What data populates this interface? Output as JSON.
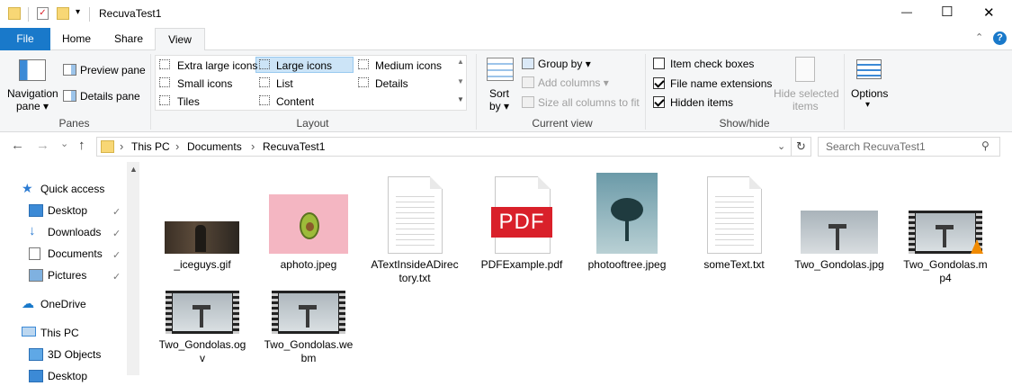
{
  "window": {
    "title": "RecuvaTest1",
    "min_label": "—",
    "max_label": "☐",
    "close_label": "✕"
  },
  "tabs": {
    "file": "File",
    "home": "Home",
    "share": "Share",
    "view": "View"
  },
  "ribbon": {
    "panes": {
      "navigation_pane": "Navigation",
      "navigation_pane2": "pane ▾",
      "preview_pane": "Preview pane",
      "details_pane": "Details pane",
      "label": "Panes"
    },
    "layout": {
      "items": [
        "Extra large icons",
        "Large icons",
        "Medium icons",
        "Small icons",
        "List",
        "Details",
        "Tiles",
        "Content"
      ],
      "selected": "Large icons",
      "label": "Layout"
    },
    "current_view": {
      "sort_by": "Sort",
      "sort_by2": "by ▾",
      "group_by": "Group by ▾",
      "add_columns": "Add columns ▾",
      "size_all_columns": "Size all columns to fit",
      "label": "Current view"
    },
    "show_hide": {
      "item_check_boxes": "Item check boxes",
      "file_name_extensions": "File name extensions",
      "hidden_items": "Hidden items",
      "item_check_boxes_checked": false,
      "file_name_extensions_checked": true,
      "hidden_items_checked": true,
      "hide_selected": "Hide selected",
      "hide_selected2": "items",
      "label": "Show/hide"
    },
    "options": {
      "label": "Options",
      "arrow": "▾"
    }
  },
  "address": {
    "back": "←",
    "forward": "→",
    "recent": "⌄",
    "up": "↑",
    "crumbs": [
      "This PC",
      "Documents",
      "RecuvaTest1"
    ],
    "sep": "›",
    "search_placeholder": "Search RecuvaTest1"
  },
  "nav": {
    "quick_access": "Quick access",
    "desktop": "Desktop",
    "downloads": "Downloads",
    "documents": "Documents",
    "pictures": "Pictures",
    "onedrive": "OneDrive",
    "this_pc": "This PC",
    "objects_3d": "3D Objects",
    "desktop2": "Desktop",
    "pin": "📌"
  },
  "files": [
    {
      "name": "_iceguys.gif"
    },
    {
      "name": "aphoto.jpeg"
    },
    {
      "name": "ATextInsideADirectory.txt"
    },
    {
      "name": "PDFExample.pdf"
    },
    {
      "name": "photooftree.jpeg"
    },
    {
      "name": "someText.txt"
    },
    {
      "name": "Two_Gondolas.jpg"
    },
    {
      "name": "Two_Gondolas.mp4"
    },
    {
      "name": "Two_Gondolas.ogv"
    },
    {
      "name": "Two_Gondolas.webm"
    }
  ],
  "pdf_badge": "PDF",
  "colors": {
    "accent": "#1979ca",
    "folder": "#f8d775",
    "pdf_red": "#d9202a"
  }
}
